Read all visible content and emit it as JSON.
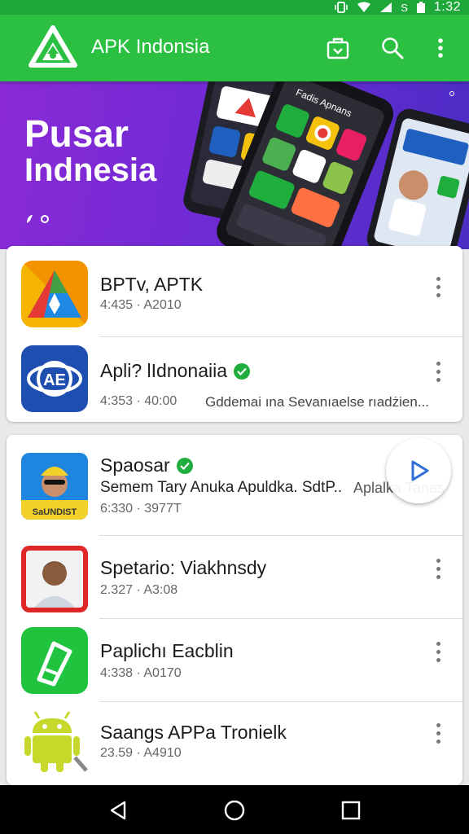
{
  "status_bar": {
    "time": "1:32",
    "icons": [
      "vibrate-icon",
      "wifi-icon",
      "signal-icon",
      "s-icon",
      "battery-icon"
    ],
    "s_label": "S"
  },
  "app_bar": {
    "title": "APK Indonsia",
    "icons": [
      "store-icon",
      "search-icon",
      "more-vert-icon"
    ]
  },
  "banner": {
    "title_line1": "Pusar",
    "title_line2": "Indnesia",
    "slides": 2,
    "active_slide": 0,
    "phone_header": "Fadis Apnans"
  },
  "list_primary": [
    {
      "title": "BPTv, APTK",
      "meta": "4:435 · A2010",
      "verified": false
    },
    {
      "title": "Apli? lIdnonaiia",
      "meta": "4:353 · 40:00",
      "desc": "Gddemai ına Sevanıaelse rıadżien...",
      "verified": true
    }
  ],
  "list_secondary": [
    {
      "title": "Spaosar",
      "desc": "Semem Tary Anuka Apuldka. SdtP..",
      "desc_extra": "Aplalka Tanas",
      "meta": "6:330 · 3977T",
      "verified": true,
      "icon_badge": "SaUNDIST"
    },
    {
      "title": "Spetario: Viakhnsdy",
      "meta": "2.327 · A3:08",
      "verified": false
    },
    {
      "title": "Paplichı Eacblin",
      "meta": "4:338 · A0170",
      "verified": false
    },
    {
      "title": "Saangs APPa Tronielk",
      "meta": "23.59 · A4910",
      "verified": false
    }
  ],
  "colors": {
    "app_bar": "#2cc043",
    "status_bar": "#1fa83a",
    "banner_start": "#8a2ad6",
    "banner_end": "#4b2dc4",
    "verified": "#1fad3d",
    "play_accent": "#2f6fd6"
  },
  "nav": [
    "back-icon",
    "home-icon",
    "recents-icon"
  ]
}
